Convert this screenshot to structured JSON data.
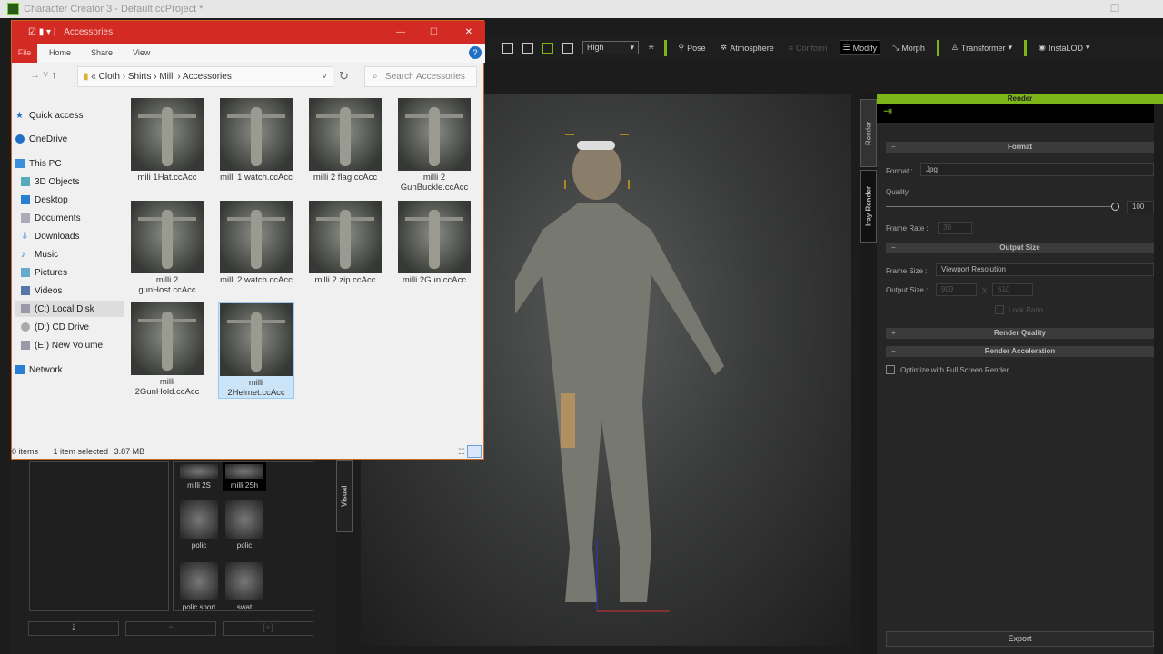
{
  "app": {
    "title": "Character Creator 3 - Default.ccProject *"
  },
  "toolbar": {
    "quality": "High",
    "items": [
      "Pose",
      "Atmosphere",
      "Conform",
      "Modify",
      "Morph",
      "Transformer",
      "InstaLOD"
    ]
  },
  "explorer": {
    "title": "Accessories",
    "ribbon": [
      "File",
      "Home",
      "Share",
      "View"
    ],
    "breadcrumb": [
      "Cloth",
      "Shirts",
      "Milli",
      "Accessories"
    ],
    "search_placeholder": "Search Accessories",
    "nav": [
      "Quick access",
      "OneDrive",
      "This PC",
      "3D Objects",
      "Desktop",
      "Documents",
      "Downloads",
      "Music",
      "Pictures",
      "Videos",
      "(C:) Local Disk",
      "(D:) CD Drive",
      "(E:) New Volume",
      "Network"
    ],
    "files": [
      "mili 1Hat.ccAcc",
      "milli 1 watch.ccAcc",
      "milli 2 flag.ccAcc",
      "milli 2 GunBuckle.ccAcc",
      "milli 2 gunHost.ccAcc",
      "milli 2 watch.ccAcc",
      "milli 2 zip.ccAcc",
      "milli 2Gun.ccAcc",
      "milli 2GunHold.ccAcc",
      "milli 2Helmet.ccAcc"
    ],
    "status": {
      "items": "0 items",
      "selected": "1 item selected",
      "size": "3.87 MB"
    }
  },
  "library": {
    "items": [
      "milli 2S",
      "milli 2Sh",
      "polic",
      "polic",
      "polic short",
      "swat"
    ],
    "side_tab": "Visual"
  },
  "render": {
    "header": "Render",
    "tabs": [
      "Render",
      "Iray Render"
    ],
    "format_section": "Format",
    "format_label": "Format :",
    "format_value": "Jpg",
    "quality_label": "Quality",
    "quality_value": "100",
    "quality_fraction": 1.0,
    "frame_rate_label": "Frame Rate :",
    "frame_rate": "30",
    "output_section": "Output Size",
    "frame_size_label": "Frame Size :",
    "frame_size": "Viewport Resolution",
    "output_size_label": "Output Size :",
    "width": "909",
    "height": "510",
    "x": "X",
    "lock_ratio": "Lock Ratio",
    "quality_section": "Render Quality",
    "accel_section": "Render Acceleration",
    "optimize": "Optimize with Full Screen Render",
    "export": "Export"
  }
}
